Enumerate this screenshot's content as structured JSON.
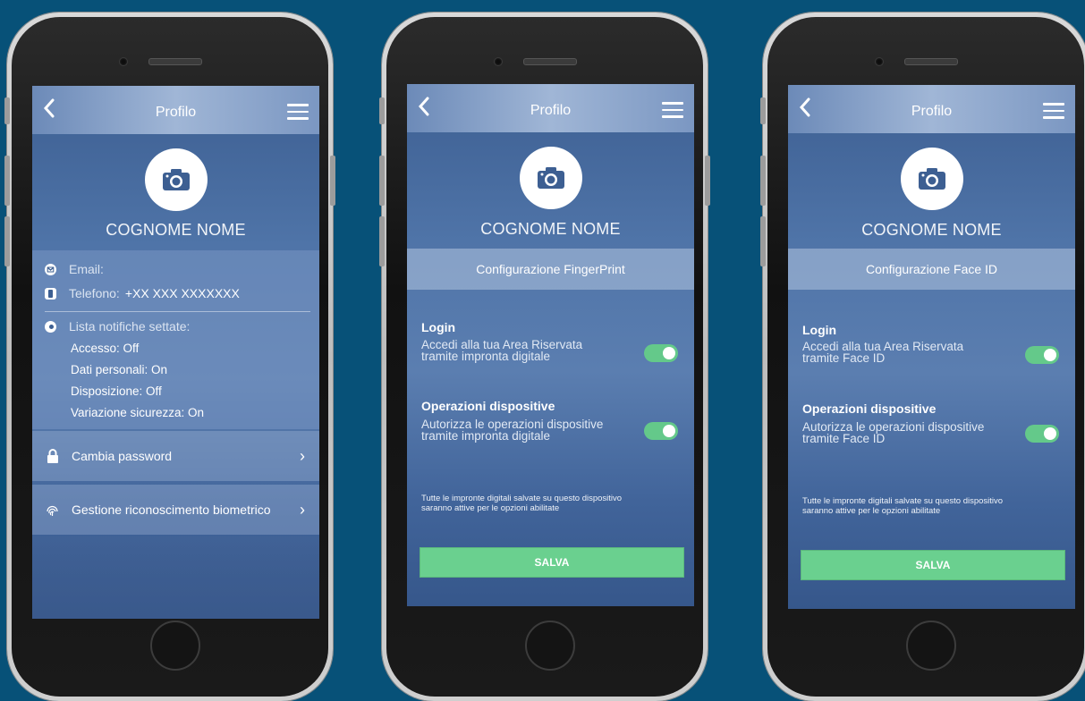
{
  "screen1": {
    "title": "Profilo",
    "name": "COGNOME NOME",
    "email_label": "Email:",
    "phone_label": "Telefono:",
    "phone_value": "+XX XXX XXXXXXX",
    "notif_title": "Lista notifiche settate:",
    "notifications": [
      "Accesso: Off",
      "Dati personali: On",
      "Disposizione: Off",
      "Variazione sicurezza: On"
    ],
    "change_password": "Cambia password",
    "biometric": "Gestione riconoscimento biometrico"
  },
  "screen2": {
    "title": "Profilo",
    "name": "COGNOME NOME",
    "section": "Configurazione FingerPrint",
    "login_title": "Login",
    "login_desc_1": "Accedi alla tua Area Riservata",
    "login_desc_2": "tramite impronta digitale",
    "ops_title": "Operazioni dispositive",
    "ops_desc_1": "Autorizza le operazioni dispositive",
    "ops_desc_2": "tramite impronta digitale",
    "note_1": "Tutte le impronte digitali salvate su questo dispositivo",
    "note_2": "saranno attive per le opzioni abilitate",
    "save": "SALVA",
    "login_enabled": true,
    "ops_enabled": true
  },
  "screen3": {
    "title": "Profilo",
    "name": "COGNOME NOME",
    "section": "Configurazione Face ID",
    "login_title": "Login",
    "login_desc_1": "Accedi alla tua Area Riservata",
    "login_desc_2": "tramite Face ID",
    "ops_title": "Operazioni dispositive",
    "ops_desc_1": "Autorizza le operazioni dispositive",
    "ops_desc_2": "tramite Face ID",
    "note_1": "Tutte le impronte digitali salvate su questo dispositivo",
    "note_2": "saranno attive per le opzioni abilitate",
    "save": "SALVA",
    "login_enabled": true,
    "ops_enabled": true
  },
  "colors": {
    "background": "#075178",
    "toggle_on": "#64c98a",
    "save_button": "#6ad08f"
  }
}
